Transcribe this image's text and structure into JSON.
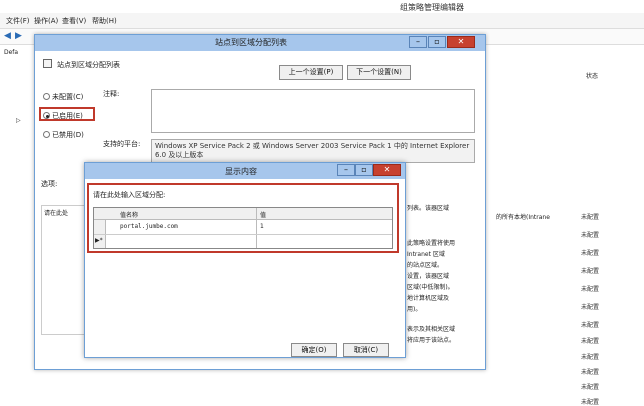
{
  "gpe": {
    "title": "组策略管理编辑器",
    "menu": [
      "文件(F)",
      "操作(A)",
      "查看(V)",
      "帮助(H)"
    ],
    "tree_item": "Defa",
    "status_header": "状态",
    "status_values": [
      "未配置",
      "未配置",
      "未配置",
      "未配置",
      "未配置",
      "未配置",
      "未配置",
      "未配置",
      "未配置",
      "未配置",
      "未配置",
      "未配置"
    ],
    "intranet_text": "的所有本地(Intrane",
    "right_text": [
      "列表。该器区域",
      "此策略设置将使用",
      "Intranet 区域",
      "的站点区域。",
      "设置，该器区域",
      "区域(中低限制)。",
      "地计算机区域及",
      "用)。",
      "表示及其相关区域",
      "将应用于该站点。"
    ]
  },
  "dialog1": {
    "title": "站点到区域分配列表",
    "subtitle": "站点到区域分配列表",
    "prev_button": "上一个设置(P)",
    "next_button": "下一个设置(N)",
    "radio_not_configured": "未配置(C)",
    "radio_enabled": "已启用(E)",
    "radio_disabled": "已禁用(D)",
    "comment_label": "注释:",
    "supported_label": "支持的平台:",
    "supported_text": "Windows XP Service Pack 2 或 Windows Server 2003 Service Pack 1 中的 Internet Explorer 6.0 及以上版本",
    "options_label": "选项:",
    "options_text": "请在此处"
  },
  "dialog2": {
    "title": "显示内容",
    "prompt": "请在此处输入区域分配:",
    "col_name": "值名称",
    "col_value": "值",
    "row_name": "portal.jumbe.com",
    "row_value": "1",
    "new_row_marker": "▶*",
    "ok_button": "确定(O)",
    "cancel_button": "取消(C)"
  }
}
